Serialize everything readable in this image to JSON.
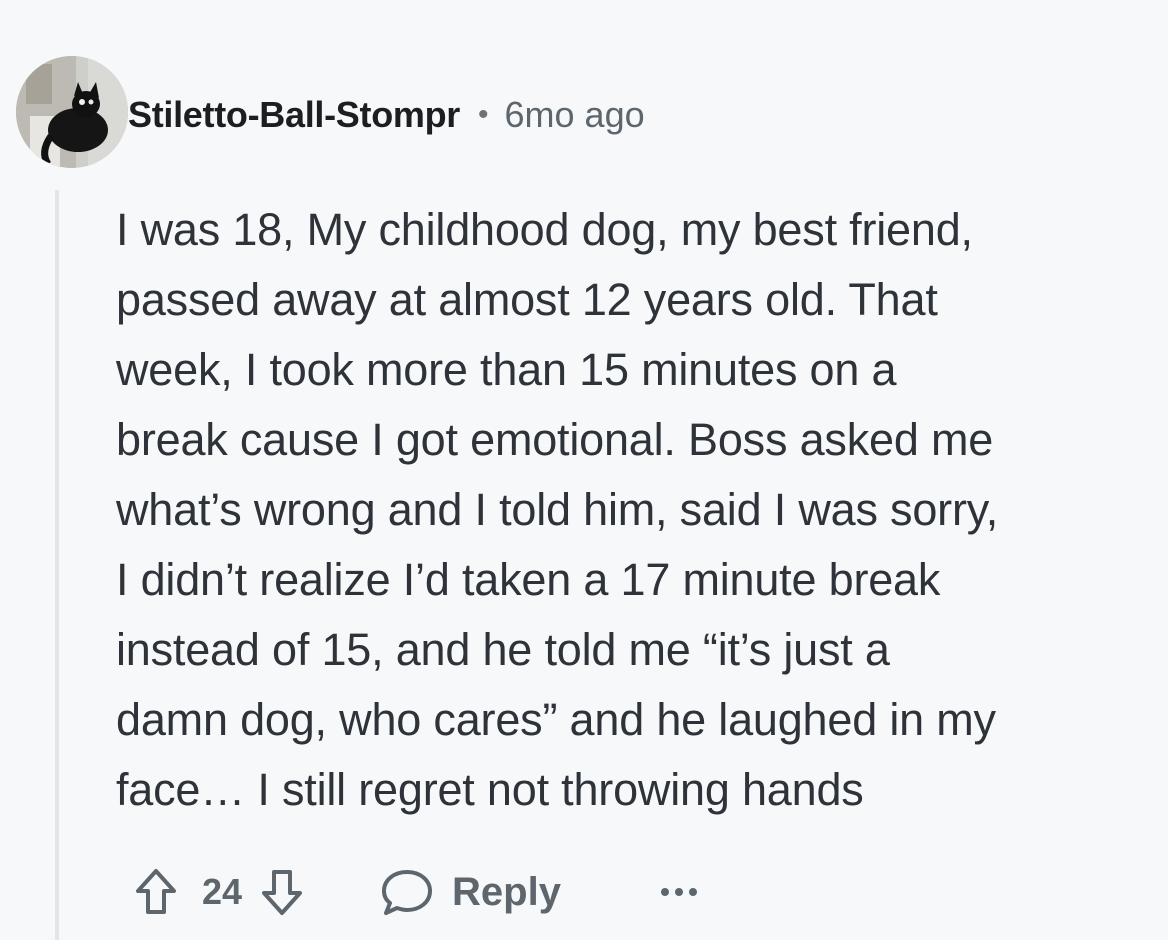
{
  "comment": {
    "author": "Stiletto-Ball-Stompr",
    "separator": "•",
    "timestamp": "6mo ago",
    "avatar_icon": "black-cat-avatar",
    "body": "I was 18, My childhood dog, my best friend,\npassed away at almost 12 years old. That\nweek, I took more than 15 minutes on a\nbreak cause I got emotional. Boss asked me\nwhat’s wrong and I told him, said I was sorry,\nI didn’t realize I’d taken a 17 minute break\ninstead of 15, and he told me “it’s just a\ndamn dog, who cares” and he laughed in my\nface… I still regret not throwing hands"
  },
  "actions": {
    "upvote_icon": "upvote-arrow-icon",
    "score": "24",
    "downvote_icon": "downvote-arrow-icon",
    "reply_icon": "speech-bubble-icon",
    "reply_label": "Reply",
    "more_icon": "more-options-icon"
  },
  "colors": {
    "background": "#f7f8fa",
    "text": "#2d3338",
    "muted": "#5d666c",
    "thread_line": "#e3e6e9"
  }
}
